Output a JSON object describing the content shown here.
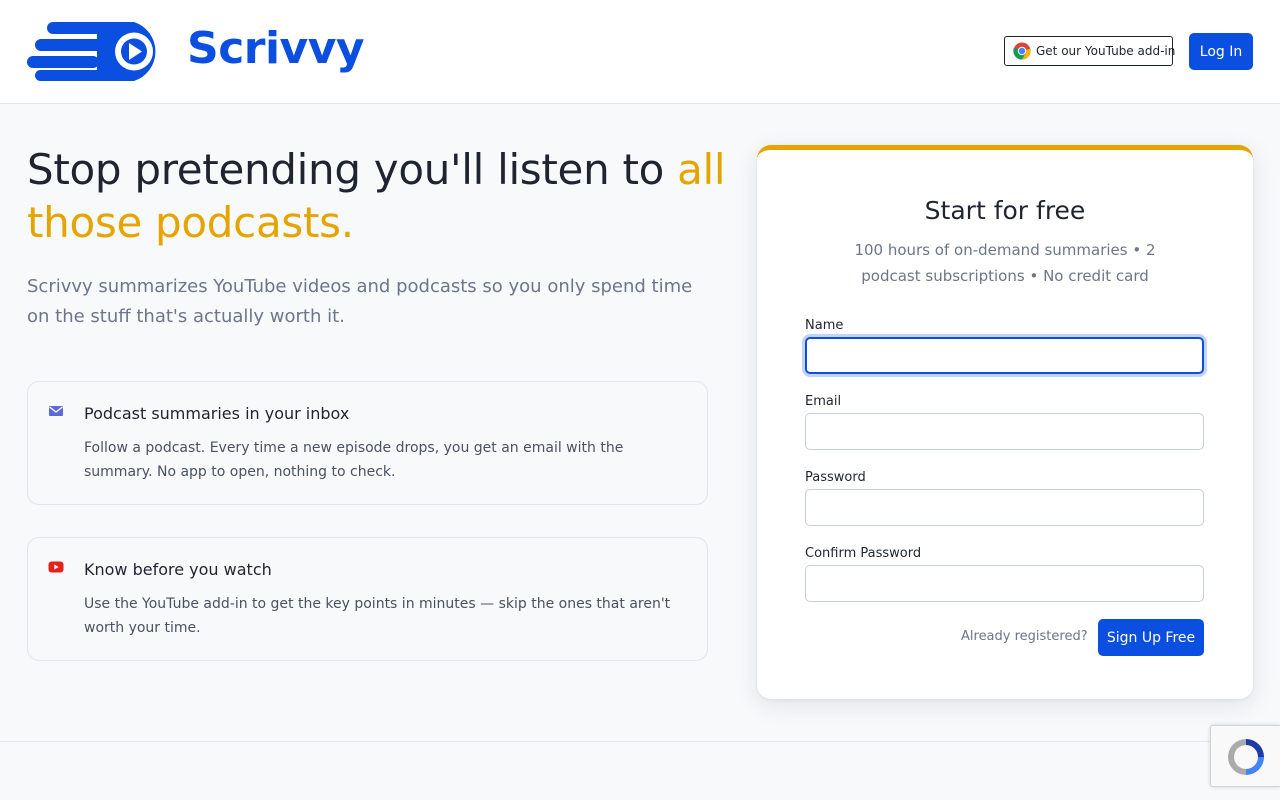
{
  "brand": {
    "name": "Scrivvy",
    "color": "#0b4fe0",
    "accent": "#e6a400"
  },
  "header": {
    "addin_label": "Get our YouTube add-in",
    "addin_icon": "chrome-icon",
    "login_label": "Log In"
  },
  "hero": {
    "title_main": "Stop pretending you'll listen to ",
    "title_accent": "all those podcasts.",
    "subtitle": "Scrivvy summarizes YouTube videos and podcasts so you only spend time on the stuff that's actually worth it."
  },
  "features": [
    {
      "icon": "envelope-icon",
      "title": "Podcast summaries in your inbox",
      "body": "Follow a podcast. Every time a new episode drops, you get an email with the summary. No app to open, nothing to check."
    },
    {
      "icon": "youtube-icon",
      "title": "Know before you watch",
      "body": "Use the YouTube add-in to get the key points in minutes — skip the ones that aren't worth your time."
    }
  ],
  "signup": {
    "title": "Start for free",
    "subtitle": "100 hours of on-demand summaries • 2 podcast subscriptions • No credit card",
    "fields": {
      "name": {
        "label": "Name",
        "value": ""
      },
      "email": {
        "label": "Email",
        "value": ""
      },
      "password": {
        "label": "Password",
        "value": ""
      },
      "confirm": {
        "label": "Confirm Password",
        "value": ""
      }
    },
    "already_label": "Already registered?",
    "submit_label": "Sign Up Free"
  },
  "recaptcha": {
    "icon": "recaptcha-icon"
  }
}
